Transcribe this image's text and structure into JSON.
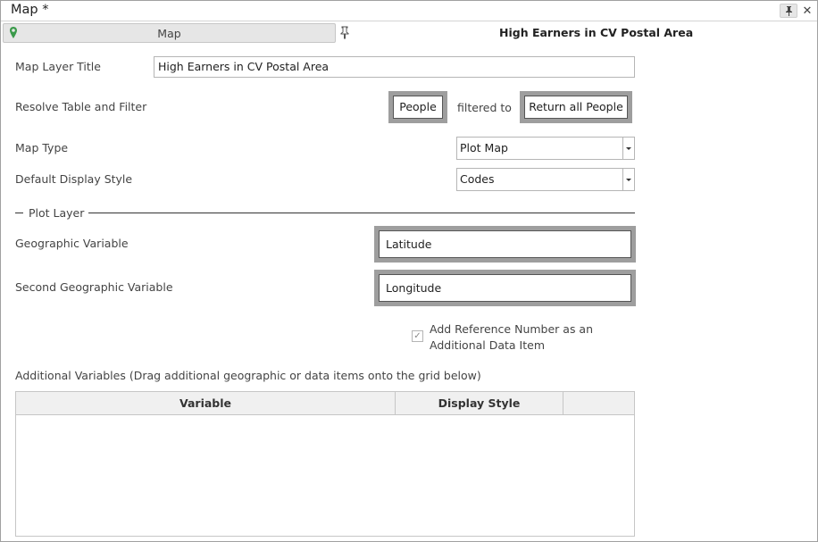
{
  "window": {
    "title": "Map *",
    "pin_icon": "pin-icon",
    "close_icon": "close-icon"
  },
  "tabs": {
    "map_tab_label": "Map",
    "active_title": "High Earners in CV Postal Area"
  },
  "form": {
    "layer_title_label": "Map Layer Title",
    "layer_title_value": "High Earners in CV Postal Area",
    "resolve_label": "Resolve Table and Filter",
    "resolve_table": "People",
    "filtered_to": "filtered to",
    "resolve_filter": "Return all People",
    "map_type_label": "Map Type",
    "map_type_value": "Plot Map",
    "display_style_label": "Default Display Style",
    "display_style_value": "Codes"
  },
  "plot_layer": {
    "group_label": "Plot Layer",
    "geo_var_label": "Geographic Variable",
    "geo_var_value": "Latitude",
    "second_geo_var_label": "Second Geographic Variable",
    "second_geo_var_value": "Longitude",
    "add_ref_line1": "Add Reference Number as an",
    "add_ref_line2": "Additional Data Item",
    "add_ref_checked": true
  },
  "additional": {
    "label": "Additional Variables (Drag additional geographic or data items onto the grid below)",
    "columns": [
      "Variable",
      "Display Style",
      ""
    ],
    "rows": []
  },
  "colors": {
    "pin_green": "#3a9a4a",
    "thick_border": "#9e9e9e"
  }
}
